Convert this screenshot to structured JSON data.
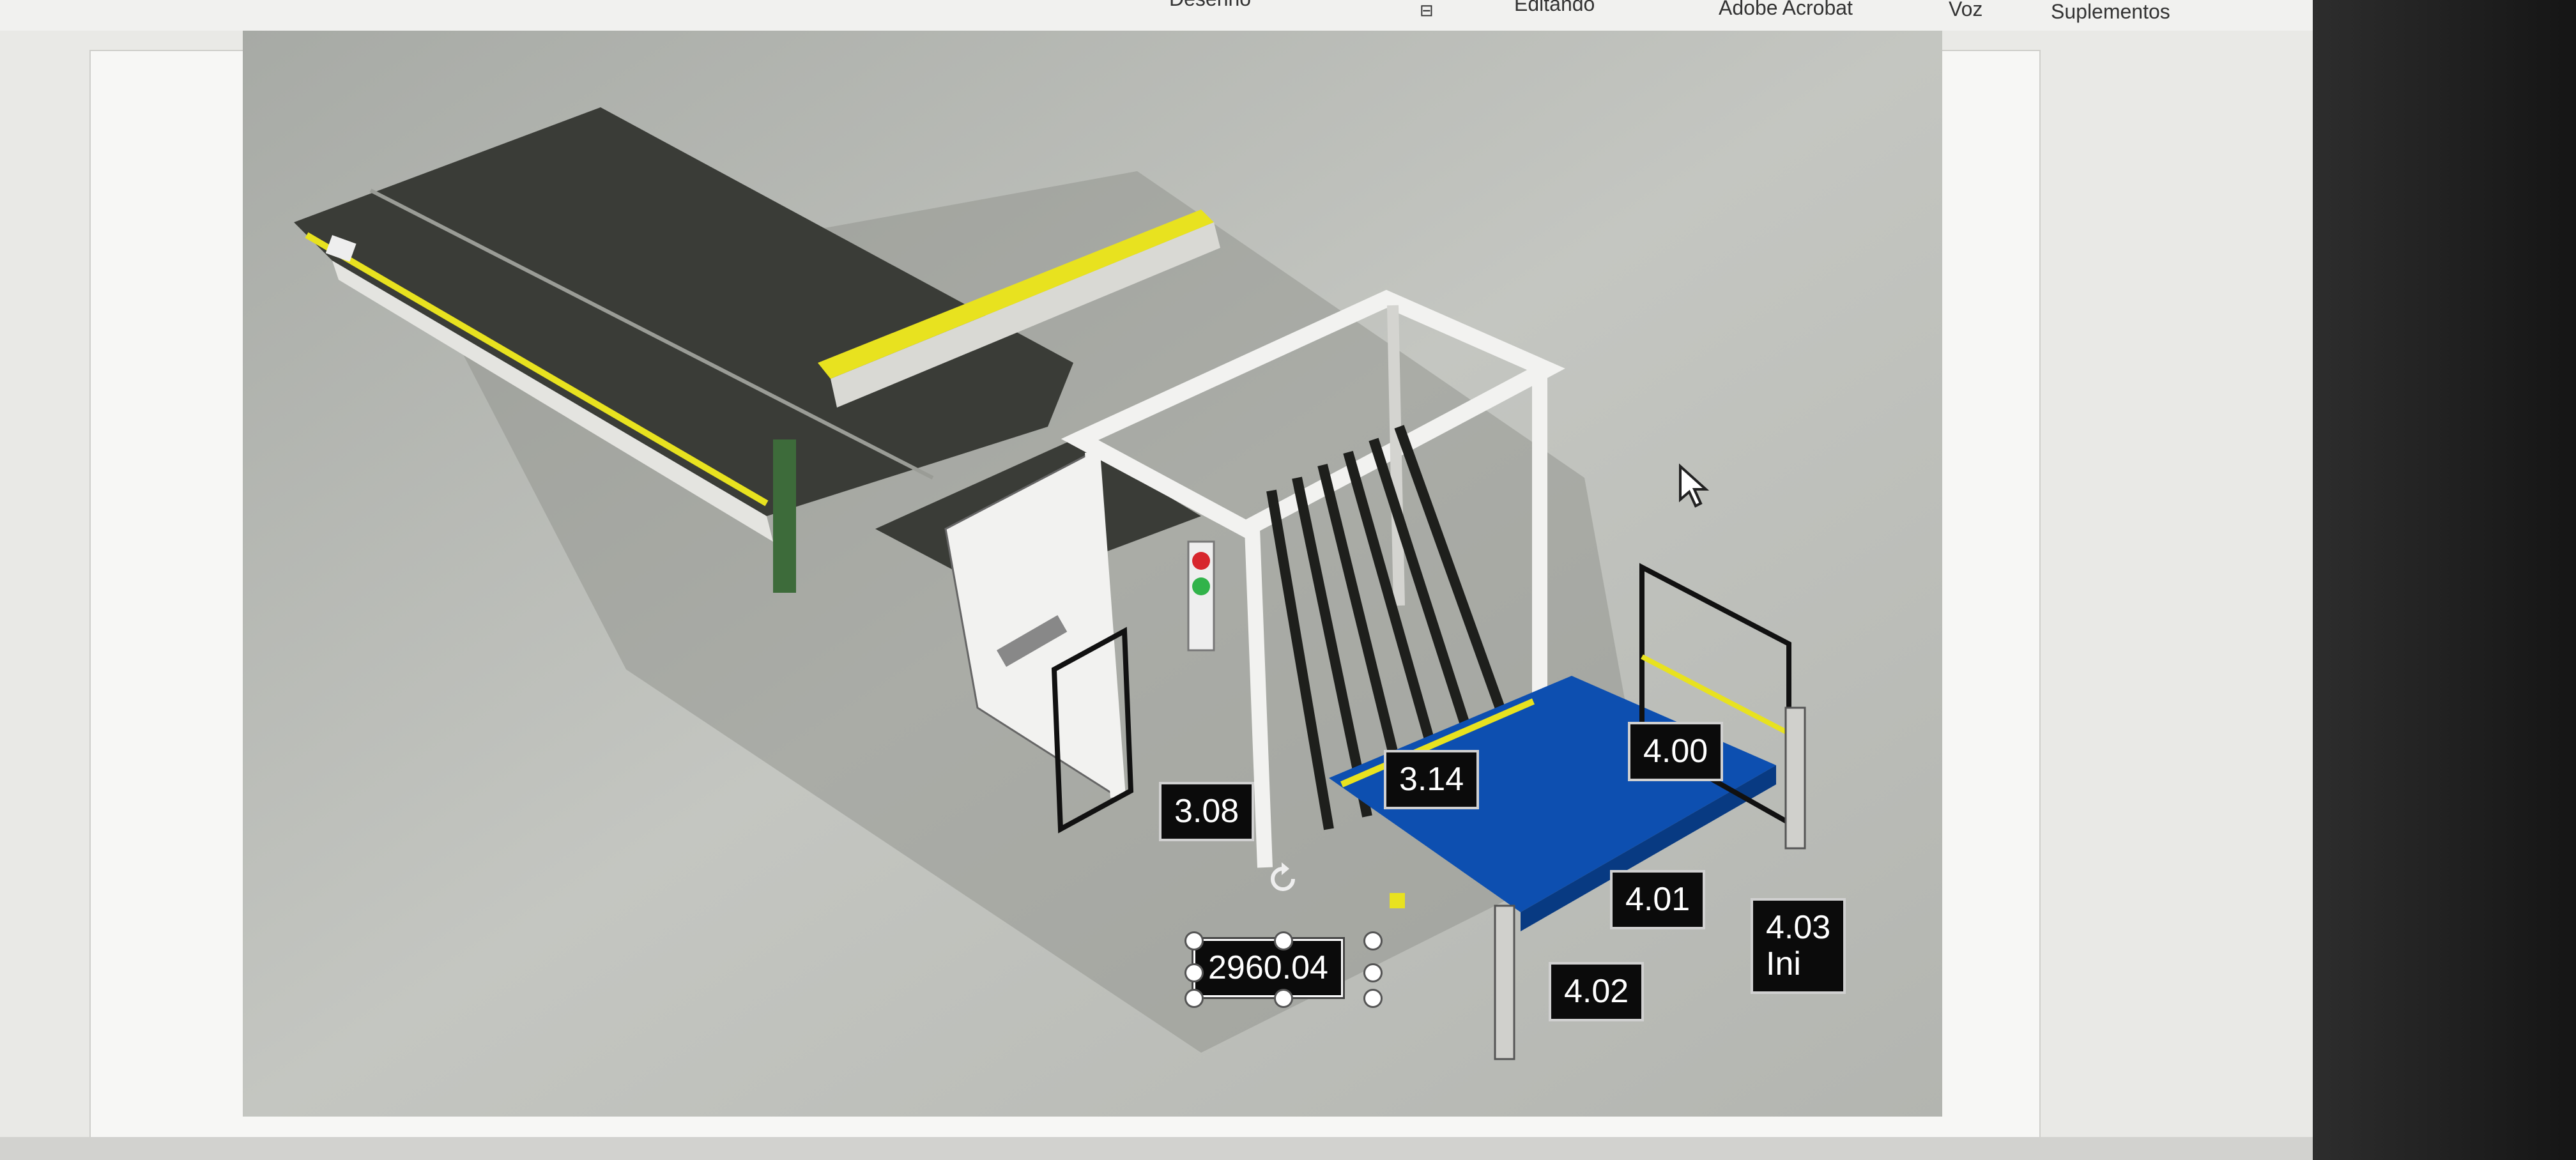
{
  "ribbon": {
    "tabs": [
      {
        "label": "Desenho",
        "cut": true
      },
      {
        "label": "Editando",
        "cut": true
      },
      {
        "label": "Adobe Acrobat",
        "cut": false
      },
      {
        "label": "Voz",
        "cut": false
      },
      {
        "label": "Suplementos",
        "cut": false
      }
    ],
    "collapse_icon": "chevron-down-icon"
  },
  "image": {
    "callouts": [
      "3.08",
      "3.14",
      "4.00",
      "4.01",
      "4.02",
      "4.03\nIni"
    ],
    "selected_box": "2960.04",
    "colors": {
      "conveyor_dark": "#3a3c37",
      "frame_white": "#f2f2f0",
      "platform_blue": "#0d4fb0",
      "safety_yellow": "#e8e21f",
      "light_red": "#d7262d",
      "light_green": "#31b34a"
    }
  }
}
